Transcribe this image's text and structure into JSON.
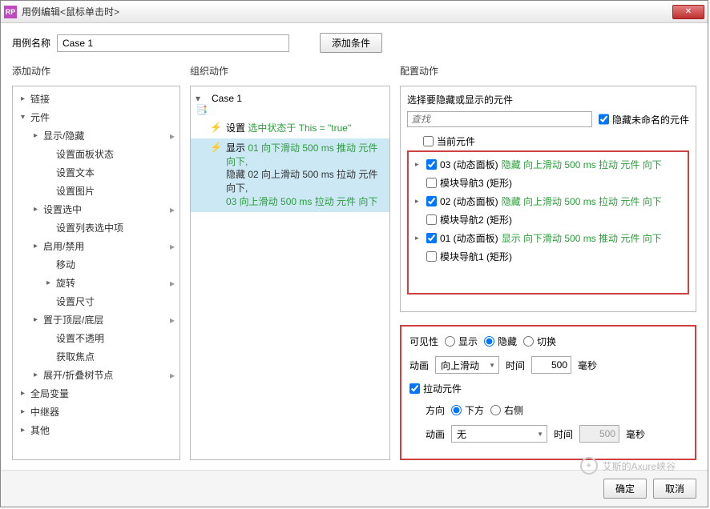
{
  "title": "用例编辑<鼠标单击时>",
  "nameLabel": "用例名称",
  "caseName": "Case 1",
  "addCondition": "添加条件",
  "col1Title": "添加动作",
  "col2Title": "组织动作",
  "col3Title": "配置动作",
  "actionsTree": [
    {
      "label": "链接",
      "level": 0,
      "caret": "▸"
    },
    {
      "label": "元件",
      "level": 0,
      "caret": "▾"
    },
    {
      "label": "显示/隐藏",
      "level": 1,
      "caret": "▸"
    },
    {
      "label": "设置面板状态",
      "level": 2,
      "caret": ""
    },
    {
      "label": "设置文本",
      "level": 2,
      "caret": ""
    },
    {
      "label": "设置图片",
      "level": 2,
      "caret": ""
    },
    {
      "label": "设置选中",
      "level": 1,
      "caret": "▸"
    },
    {
      "label": "设置列表选中项",
      "level": 2,
      "caret": ""
    },
    {
      "label": "启用/禁用",
      "level": 1,
      "caret": "▸"
    },
    {
      "label": "移动",
      "level": 2,
      "caret": ""
    },
    {
      "label": "旋转",
      "level": 2,
      "caret": "▸"
    },
    {
      "label": "设置尺寸",
      "level": 2,
      "caret": ""
    },
    {
      "label": "置于顶层/底层",
      "level": 1,
      "caret": "▸"
    },
    {
      "label": "设置不透明",
      "level": 2,
      "caret": ""
    },
    {
      "label": "获取焦点",
      "level": 2,
      "caret": ""
    },
    {
      "label": "展开/折叠树节点",
      "level": 1,
      "caret": "▸"
    },
    {
      "label": "全局变量",
      "level": 0,
      "caret": "▸"
    },
    {
      "label": "中继器",
      "level": 0,
      "caret": "▸"
    },
    {
      "label": "其他",
      "level": 0,
      "caret": "▸"
    }
  ],
  "orgCase": "Case 1",
  "orgSet": {
    "pre": "设置 ",
    "green": "选中状态于 This = \"true\""
  },
  "orgShow": {
    "pre": "显示 ",
    "l1": "01 向下滑动 500 ms 推动 元件 向下,",
    "l2": "隐藏 02 向上滑动 500 ms 拉动 元件 向下,",
    "l3": "03 向上滑动 500 ms 拉动 元件 向下"
  },
  "cfgSelectLabel": "选择要隐藏或显示的元件",
  "searchPlaceholder": "查找",
  "hideUnnamed": "隐藏未命名的元件",
  "elemCurrent": "当前元件",
  "elems": [
    {
      "checked": true,
      "tri": "▸",
      "name": "03 (动态面板)",
      "green": "隐藏 向上滑动 500 ms 拉动 元件 向下"
    },
    {
      "checked": false,
      "tri": "",
      "name": "模块导航3 (矩形)",
      "green": ""
    },
    {
      "checked": true,
      "tri": "▸",
      "name": "02 (动态面板)",
      "green": "隐藏 向上滑动 500 ms 拉动 元件 向下"
    },
    {
      "checked": false,
      "tri": "",
      "name": "模块导航2 (矩形)",
      "green": ""
    },
    {
      "checked": true,
      "tri": "▸",
      "name": "01 (动态面板)",
      "green": "显示 向下滑动 500 ms 推动 元件 向下"
    },
    {
      "checked": false,
      "tri": "",
      "name": "模块导航1 (矩形)",
      "green": ""
    }
  ],
  "visLabel": "可见性",
  "visShow": "显示",
  "visHide": "隐藏",
  "visToggle": "切换",
  "animLabel": "动画",
  "animVal": "向上滑动",
  "timeLabel": "时间",
  "timeVal": "500",
  "ms": "毫秒",
  "pullLabel": "拉动元件",
  "dirLabel": "方向",
  "dirDown": "下方",
  "dirRight": "右侧",
  "anim2Label": "动画",
  "anim2Val": "无",
  "time2Label": "时间",
  "time2Val": "500",
  "ms2": "毫秒",
  "ok": "确定",
  "cancel": "取消",
  "watermark": "艾斯的Axure峡谷"
}
